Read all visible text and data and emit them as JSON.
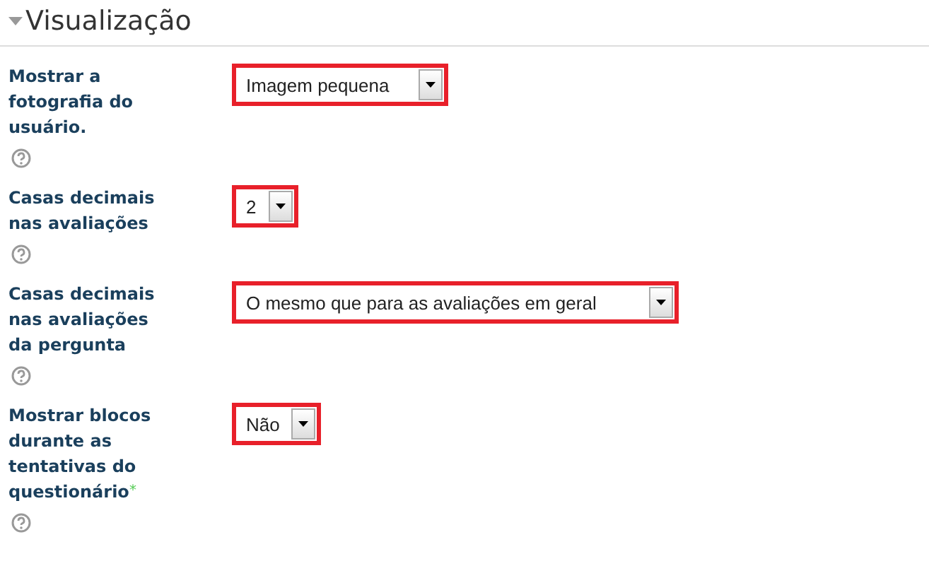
{
  "section": {
    "title": "Visualização",
    "expanded": true
  },
  "fields": [
    {
      "label": "Mostrar a fotografia do usuário.",
      "value": "Imagem pequena"
    },
    {
      "label": "Casas decimais nas avaliações",
      "value": "2"
    },
    {
      "label": "Casas decimais nas avaliações da pergunta",
      "value": "O mesmo que para as avaliações em geral"
    },
    {
      "label": "Mostrar blocos durante as tentativas do questionário",
      "value": "Não",
      "advanced_mark": "*"
    }
  ]
}
